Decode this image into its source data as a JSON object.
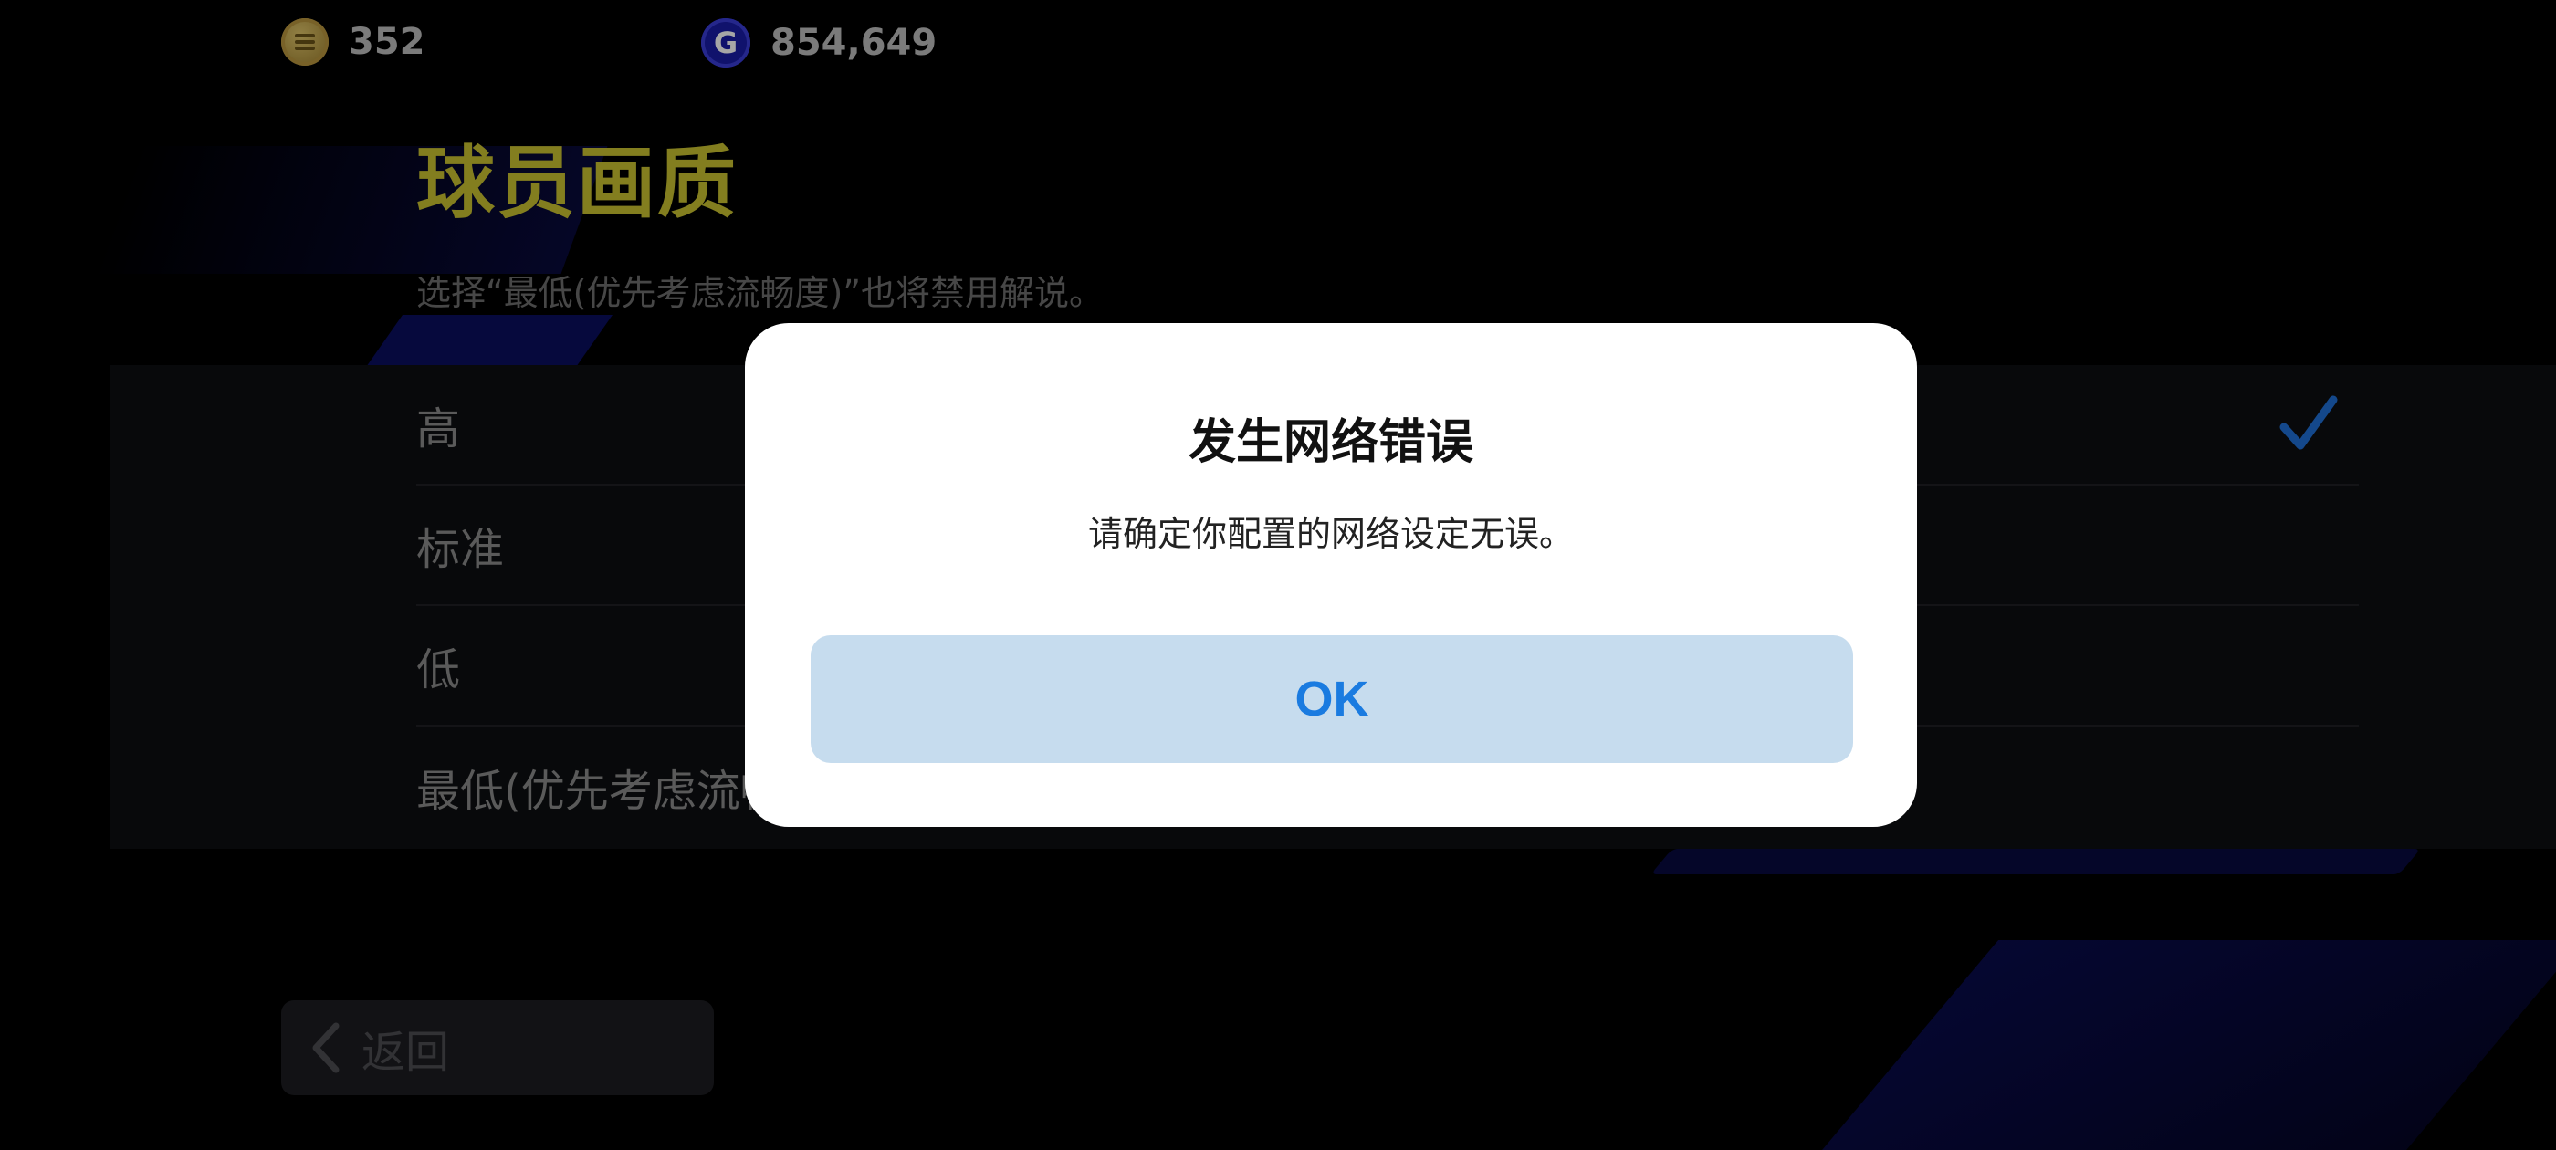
{
  "header": {
    "coins": "352",
    "gp": "854,649",
    "gp_icon_glyph": "G"
  },
  "page": {
    "title": "球员画质",
    "description": "选择“最低(优先考虑流畅度)”也将禁用解说。"
  },
  "options": [
    {
      "label": "高",
      "selected": true
    },
    {
      "label": "标准",
      "selected": false
    },
    {
      "label": "低",
      "selected": false
    },
    {
      "label": "最低(优先考虑流畅度)",
      "selected": false
    }
  ],
  "back_button": {
    "label": "返回"
  },
  "dialog": {
    "title": "发生网络错误",
    "message": "请确定你配置的网络设定无误。",
    "ok_label": "OK"
  },
  "colors": {
    "title": "#c9c230",
    "check": "#1f6fd6",
    "ok_bg": "#c6dcee",
    "ok_text": "#1a7be0"
  },
  "icons": [
    "coin-icon",
    "gp-icon",
    "checkmark-icon",
    "chevron-left-icon"
  ]
}
